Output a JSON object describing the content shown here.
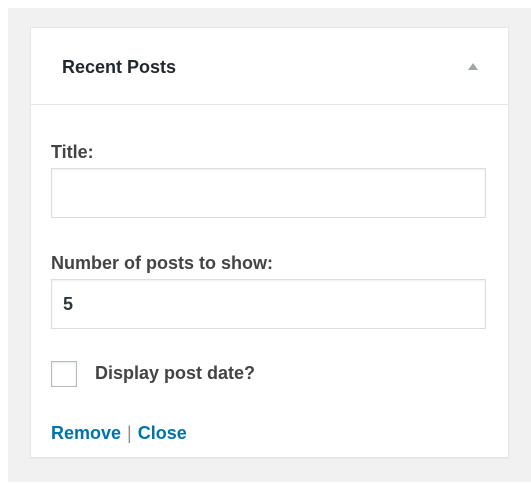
{
  "widget": {
    "title": "Recent Posts",
    "toggle_icon": "triangle-up-icon",
    "fields": {
      "title": {
        "label": "Title:",
        "value": ""
      },
      "number": {
        "label": "Number of posts to show:",
        "value": "5"
      }
    },
    "checkbox": {
      "label": "Display post date?",
      "checked": false
    },
    "actions": {
      "remove": "Remove",
      "separator": "|",
      "close": "Close"
    }
  },
  "colors": {
    "link": "#0073aa",
    "text": "#444444",
    "border": "#e5e5e5",
    "backdrop": "#f1f1f1"
  }
}
